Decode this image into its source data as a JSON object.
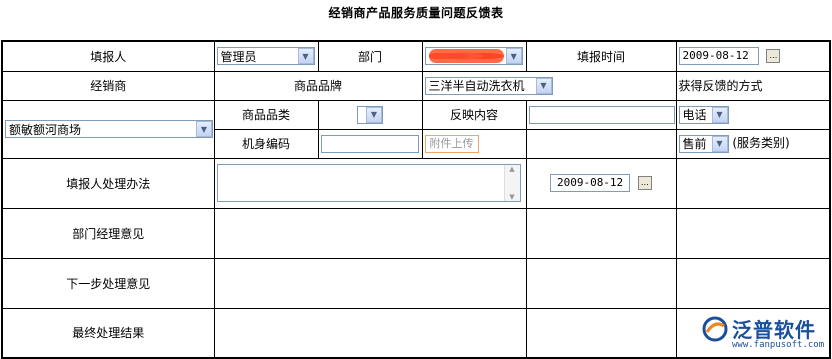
{
  "title": "经销商产品服务质量问题反馈表",
  "row1": {
    "reporter_label": "填报人",
    "reporter_value": "管理员",
    "dept_label": "部门",
    "time_label": "填报时间",
    "time_value": "2009-08-12"
  },
  "row2": {
    "dealer_label": "经销商",
    "brand_label": "商品品牌",
    "brand_value": "三洋半自动洗衣机",
    "feedback_label": "获得反馈的方式"
  },
  "row3": {
    "dealer_value": "额敏额河商场",
    "category_label": "商品品类",
    "category_value": "",
    "content_label": "反映内容",
    "content_value": "",
    "method_value": "电话"
  },
  "row4": {
    "serial_label": "机身编码",
    "serial_value": "",
    "upload_label": "附件上传",
    "service_value": "售前",
    "service_suffix": "(服务类别)"
  },
  "row5": {
    "handle_label": "填报人处理办法",
    "date_value": "2009-08-12"
  },
  "row6": {
    "label": "部门经理意见"
  },
  "row7": {
    "label": "下一步处理意见"
  },
  "row8": {
    "label": "最终处理结果"
  },
  "logo": {
    "brand": "泛普软件",
    "url": "www.fanpusoft.com"
  }
}
